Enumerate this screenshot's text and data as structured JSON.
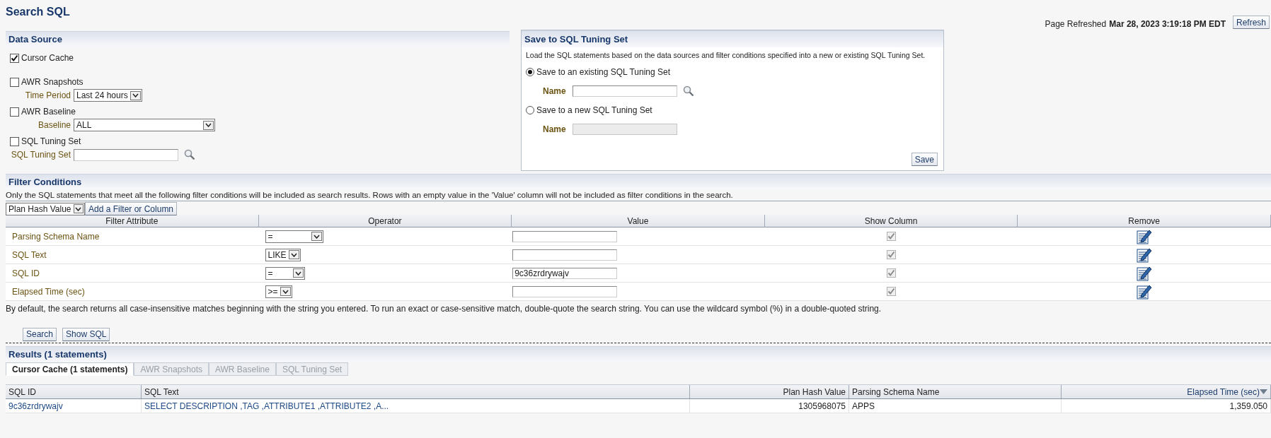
{
  "title": "Search SQL",
  "page_refreshed": {
    "label": "Page Refreshed",
    "value": "Mar 28, 2023 3:19:18 PM EDT",
    "button": "Refresh"
  },
  "data_source": {
    "heading": "Data Source",
    "sources": [
      {
        "label": "Cursor Cache",
        "checked": true
      },
      {
        "label": "AWR Snapshots",
        "checked": false,
        "field": {
          "kind": "select",
          "label": "Time Period",
          "value": "Last 24 hours"
        }
      },
      {
        "label": "AWR Baseline",
        "checked": false,
        "field": {
          "kind": "select",
          "label": "Baseline",
          "value": "ALL"
        }
      },
      {
        "label": "SQL Tuning Set",
        "checked": false,
        "field": {
          "kind": "lookup",
          "label": "SQL Tuning Set"
        }
      }
    ]
  },
  "save_panel": {
    "heading": "Save to SQL Tuning Set",
    "description": "Load the SQL statements based on the data sources and filter conditions specified into a new or existing SQL Tuning Set.",
    "options": [
      {
        "label": "Save to an existing SQL Tuning Set",
        "selected": true,
        "field_label": "Name",
        "disabled": false
      },
      {
        "label": "Save to a new SQL Tuning Set",
        "selected": false,
        "field_label": "Name",
        "disabled": true
      }
    ],
    "save_button": "Save"
  },
  "filter": {
    "heading": "Filter Conditions",
    "description": "Only the SQL statements that meet all the following filter conditions will be included as search results. Rows with an empty value in the 'Value' column will not be included as filter conditions in the search.",
    "add_select": "Plan Hash Value",
    "add_button": "Add a Filter or Column",
    "columns": [
      "Filter Attribute",
      "Operator",
      "Value",
      "Show Column",
      "Remove"
    ],
    "rows": [
      {
        "attribute": "Parsing Schema Name",
        "operator": "=",
        "value": "",
        "show_column": true
      },
      {
        "attribute": "SQL Text",
        "operator": "LIKE",
        "value": "",
        "show_column": true
      },
      {
        "attribute": "SQL ID",
        "operator": "=",
        "value": "9c36zrdrywajv",
        "show_column": true
      },
      {
        "attribute": "Elapsed Time (sec)",
        "operator": ">=",
        "value": "",
        "show_column": true
      }
    ],
    "note": "By default, the search returns all case-insensitive matches beginning with the string you entered. To run an exact or case-sensitive match, double-quote the search string. You can use the wildcard symbol (%) in a double-quoted string."
  },
  "buttons": [
    "Search",
    "Show SQL"
  ],
  "results": {
    "heading": "Results (1 statements)",
    "tabs": [
      {
        "label": "Cursor Cache (1 statements)",
        "selected": true
      },
      {
        "label": "AWR Snapshots",
        "selected": false
      },
      {
        "label": "AWR Baseline",
        "selected": false
      },
      {
        "label": "SQL Tuning Set",
        "selected": false
      }
    ],
    "columns": [
      {
        "label": "SQL ID",
        "sorted": false
      },
      {
        "label": "SQL Text",
        "sorted": false
      },
      {
        "label": "Plan Hash Value",
        "sorted": false
      },
      {
        "label": "Parsing Schema Name",
        "sorted": false
      },
      {
        "label": "Elapsed Time (sec)",
        "sorted": true
      }
    ],
    "rows": [
      {
        "cells": [
          {
            "text": "9c36zrdrywajv",
            "link": true
          },
          {
            "text": "SELECT DESCRIPTION ,TAG ,ATTRIBUTE1 ,ATTRIBUTE2 ,A...",
            "link": true
          },
          {
            "text": "1305968075",
            "link": false
          },
          {
            "text": "APPS",
            "link": false
          },
          {
            "text": "1,359.050",
            "link": false
          }
        ]
      }
    ]
  }
}
